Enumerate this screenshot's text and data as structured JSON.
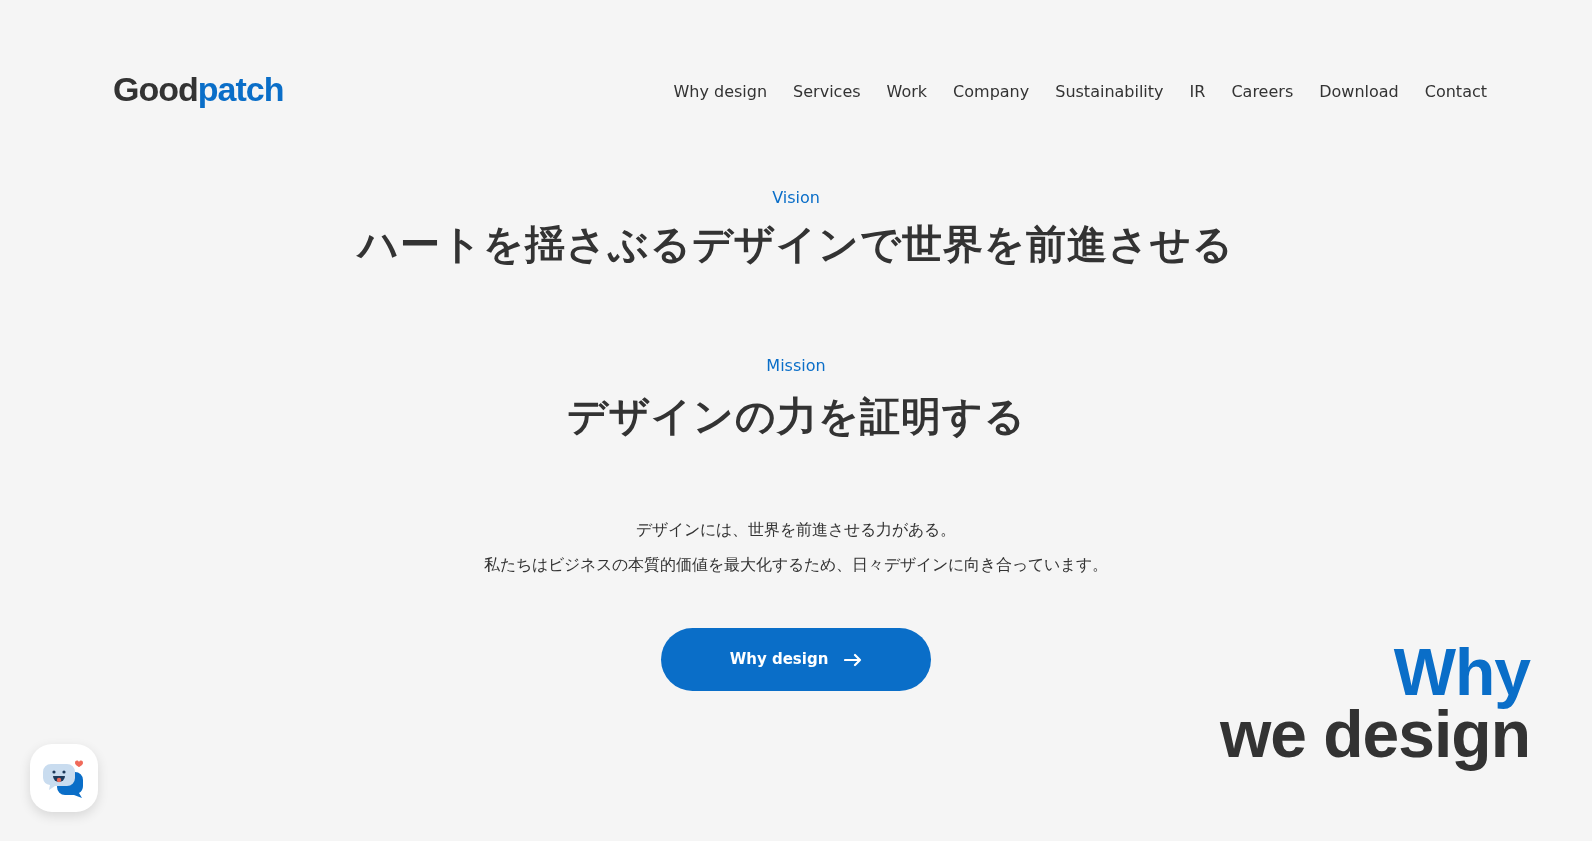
{
  "logo": {
    "first": "Good",
    "second": "patch"
  },
  "nav": [
    {
      "label": "Why design"
    },
    {
      "label": "Services"
    },
    {
      "label": "Work"
    },
    {
      "label": "Company"
    },
    {
      "label": "Sustainability"
    },
    {
      "label": "IR"
    },
    {
      "label": "Careers"
    },
    {
      "label": "Download"
    },
    {
      "label": "Contact"
    }
  ],
  "vision": {
    "label": "Vision",
    "heading": "ハートを揺さぶるデザインで世界を前進させる"
  },
  "mission": {
    "label": "Mission",
    "heading": "デザインの力を証明する"
  },
  "body": [
    "デザインには、世界を前進させる力がある。",
    "私たちはビジネスの本質的価値を最大化するため、日々デザインに向き合っています。"
  ],
  "button": {
    "label": "Why design"
  },
  "tagline": {
    "first": "Why",
    "second": "we design"
  }
}
